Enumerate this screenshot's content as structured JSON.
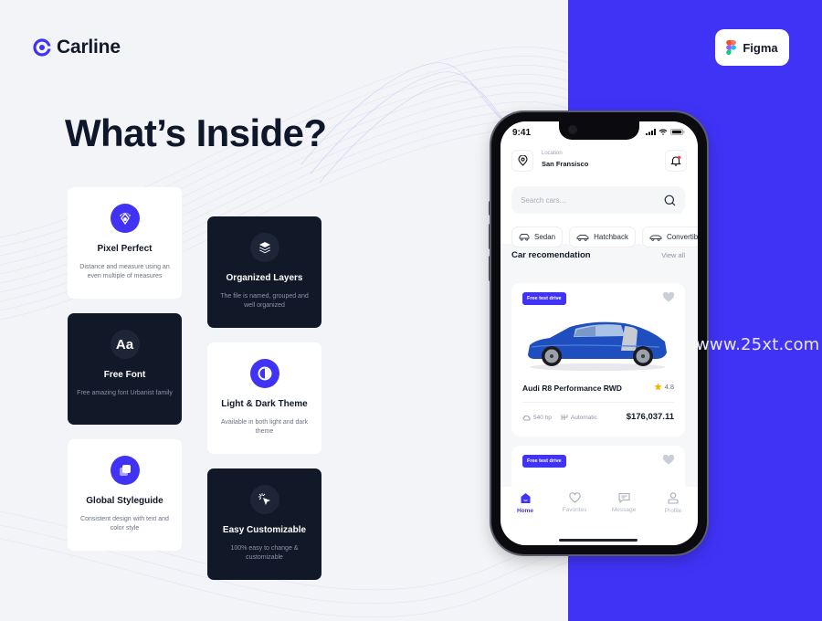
{
  "brand": {
    "name": "Carline",
    "accent": "#4133f6"
  },
  "page_title": "What’s Inside?",
  "figma_badge": {
    "label": "Figma",
    "icon": "figma-logo-icon"
  },
  "watermark": "www.25xt.com",
  "features": [
    {
      "icon": "pen-tool-icon",
      "title": "Pixel Perfect",
      "desc": "Distance and measure using an even multiple of measures",
      "theme": "light"
    },
    {
      "icon": "layers-icon",
      "title": "Organized Layers",
      "desc": "The file is named, grouped and well organized",
      "theme": "dark"
    },
    {
      "icon": "font-icon",
      "icon_text": "Aa",
      "title": "Free Font",
      "desc": "Free amazing font Urbanist family",
      "theme": "dark"
    },
    {
      "icon": "theme-toggle-icon",
      "title": "Light & Dark Theme",
      "desc": "Available in both light and dark theme",
      "theme": "light"
    },
    {
      "icon": "styleguide-icon",
      "title": "Global Styleguide",
      "desc": "Consistent design with text and color style",
      "theme": "light"
    },
    {
      "icon": "cursor-click-icon",
      "title": "Easy Customizable",
      "desc": "100% easy to change & customizable",
      "theme": "dark"
    }
  ],
  "phone": {
    "status_time": "9:41",
    "location_label": "Location",
    "location_value": "San Fransisco",
    "search_placeholder": "Search cars...",
    "categories": [
      {
        "label": "Sedan",
        "icon": "sedan-icon"
      },
      {
        "label": "Hatchback",
        "icon": "hatchback-icon"
      },
      {
        "label": "Convertible",
        "icon": "convertible-icon"
      }
    ],
    "section_title": "Car recomendation",
    "view_all": "View all",
    "cars": [
      {
        "badge": "Free test drive",
        "name": "Audi R8 Performance RWD",
        "rating": "4.8",
        "horsepower": "540 hp",
        "transmission": "Automatic",
        "price": "$176,037.11",
        "color": "#1f4fbf"
      },
      {
        "badge": "Free test drive"
      }
    ],
    "tabs": [
      {
        "label": "Home",
        "icon": "home-icon",
        "active": true
      },
      {
        "label": "Favorites",
        "icon": "heart-icon",
        "active": false
      },
      {
        "label": "Message",
        "icon": "message-icon",
        "active": false
      },
      {
        "label": "Profile",
        "icon": "profile-icon",
        "active": false
      }
    ]
  }
}
